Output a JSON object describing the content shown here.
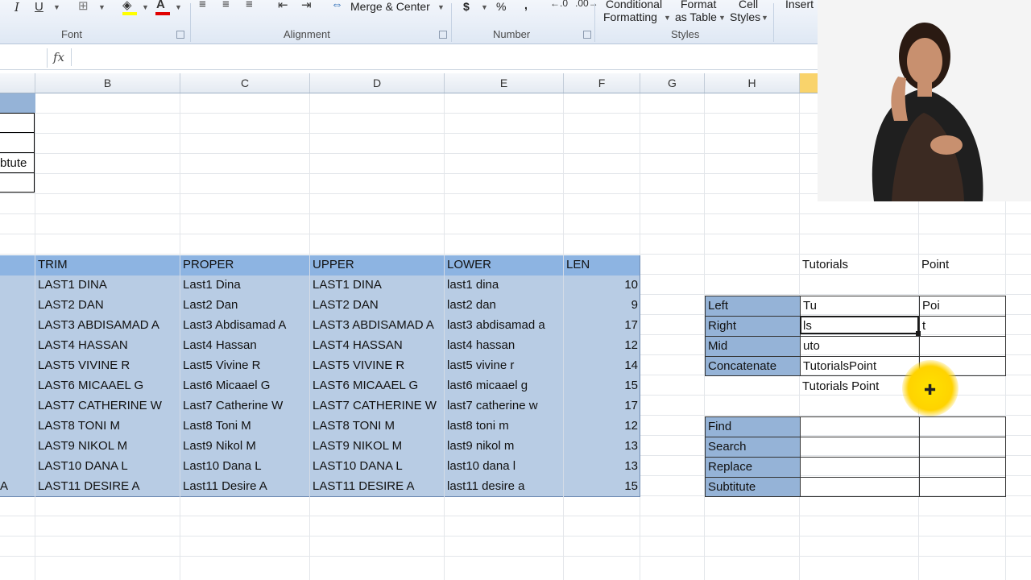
{
  "ribbon": {
    "groups": {
      "font": "Font",
      "alignment": "Alignment",
      "number": "Number",
      "styles": "Styles"
    },
    "merge_center": "Merge & Center",
    "conditional_formatting": [
      "Conditional",
      "Formatting"
    ],
    "format_as_table": [
      "Format",
      "as Table"
    ],
    "cell_styles": [
      "Cell",
      "Styles"
    ],
    "insert": "Insert",
    "currency_symbol": "$",
    "percent_symbol": "%",
    "comma_symbol": ","
  },
  "formula_bar": {
    "fx": "fx",
    "value": ""
  },
  "columns": [
    "B",
    "C",
    "D",
    "E",
    "F",
    "G",
    "H"
  ],
  "partial_cells": {
    "a4": "btute",
    "a15": "A"
  },
  "main_table": {
    "headers": [
      "TRIM",
      "PROPER",
      "UPPER",
      "LOWER",
      "LEN"
    ],
    "rows": [
      [
        "LAST1 DINA",
        "Last1 Dina",
        "LAST1 DINA",
        "last1 dina",
        "10"
      ],
      [
        "LAST2 DAN",
        "Last2 Dan",
        "LAST2 DAN",
        "last2 dan",
        "9"
      ],
      [
        "LAST3 ABDISAMAD A",
        "Last3 Abdisamad A",
        "LAST3 ABDISAMAD A",
        "last3 abdisamad a",
        "17"
      ],
      [
        "LAST4 HASSAN",
        "Last4 Hassan",
        "LAST4 HASSAN",
        "last4 hassan",
        "12"
      ],
      [
        "LAST5 VIVINE R",
        "Last5 Vivine R",
        "LAST5 VIVINE R",
        "last5 vivine r",
        "14"
      ],
      [
        "LAST6 MICAAEL G",
        "Last6 Micaael G",
        "LAST6 MICAAEL G",
        "last6 micaael g",
        "15"
      ],
      [
        "LAST7 CATHERINE W",
        "Last7 Catherine W",
        "LAST7 CATHERINE W",
        "last7 catherine w",
        "17"
      ],
      [
        "LAST8 TONI M",
        "Last8 Toni M",
        "LAST8 TONI M",
        "last8 toni m",
        "12"
      ],
      [
        "LAST9 NIKOL M",
        "Last9 Nikol M",
        "LAST9 NIKOL M",
        "last9 nikol m",
        "13"
      ],
      [
        "LAST10 DANA L",
        "Last10 Dana L",
        "LAST10 DANA L",
        "last10 dana l",
        "13"
      ],
      [
        "LAST11 DESIRE A",
        "Last11 Desire A",
        "LAST11 DESIRE A",
        "last11 desire a",
        "15"
      ]
    ]
  },
  "functions_table": {
    "header_values": [
      "Tutorials",
      "Point"
    ],
    "rows": [
      {
        "label": "Left",
        "v1": "Tu",
        "v2": "Poi"
      },
      {
        "label": "Right",
        "v1": "ls",
        "v2": "t"
      },
      {
        "label": "Mid",
        "v1": "uto",
        "v2": ""
      },
      {
        "label": "Concatenate",
        "v1": "TutorialsPoint",
        "v2": ""
      }
    ],
    "extra_value": "Tutorials Point",
    "rows2": [
      {
        "label": "Find"
      },
      {
        "label": "Search"
      },
      {
        "label": "Replace"
      },
      {
        "label": "Subtitute"
      }
    ]
  },
  "colors": {
    "header_fill": "#8db4e2",
    "label_fill": "#95b3d7",
    "row_fill": "#b8cce4",
    "selected_column": "#f9d36b",
    "cursor_highlight": "#ffd300"
  }
}
